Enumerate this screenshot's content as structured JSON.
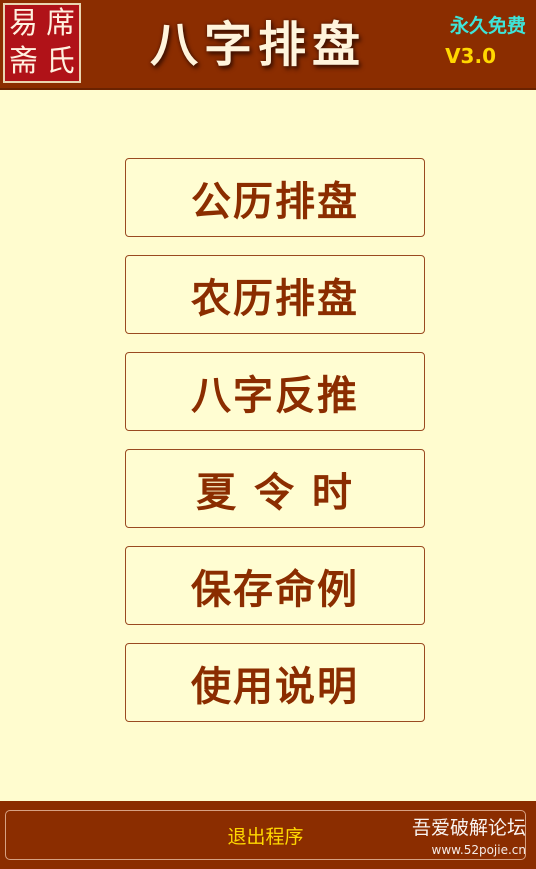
{
  "header": {
    "seal_chars": [
      "易",
      "席",
      "斋",
      "氏"
    ],
    "title": "八字排盘",
    "free_tag": "永久免费",
    "version": "V3.0"
  },
  "menu": {
    "items": [
      {
        "label": "公历排盘"
      },
      {
        "label": "农历排盘"
      },
      {
        "label": "八字反推"
      },
      {
        "label": "夏 令 时"
      },
      {
        "label": "保存命例"
      },
      {
        "label": "使用说明"
      }
    ]
  },
  "footer": {
    "exit_label": "退出程序",
    "watermark_cn": "吾爱破解论坛",
    "watermark_url": "www.52pojie.cn"
  }
}
